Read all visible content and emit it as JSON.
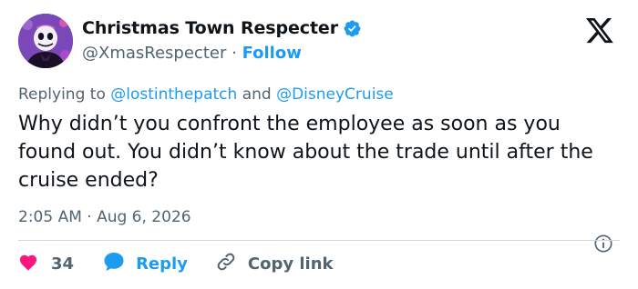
{
  "author": {
    "display_name": "Christmas Town Respecter",
    "handle": "@XmasRespecter",
    "separator": "·",
    "follow_label": "Follow",
    "verified": true
  },
  "reply_context": {
    "prefix": "Replying to",
    "mentions": [
      "@lostinthepatch",
      "@DisneyCruise"
    ],
    "joiner": "and"
  },
  "tweet": {
    "text": "Why didn’t you confront the employee as soon as you found out. You didn’t know about the trade until after the cruise ended?",
    "timestamp": "2:05 AM · Aug 6, 2026"
  },
  "actions": {
    "like_count": "34",
    "reply_label": "Reply",
    "copy_label": "Copy link"
  },
  "colors": {
    "accent": "#1d9bf0",
    "like": "#f91880",
    "text": "#0f1419",
    "muted": "#536471",
    "divider": "#cfd9de"
  },
  "icons": {
    "avatar": "jack-skellington-avatar",
    "verified": "verified-badge-icon",
    "platform": "x-logo-icon",
    "info": "info-icon",
    "like": "heart-icon",
    "reply": "speech-bubble-icon",
    "copy": "link-icon"
  }
}
